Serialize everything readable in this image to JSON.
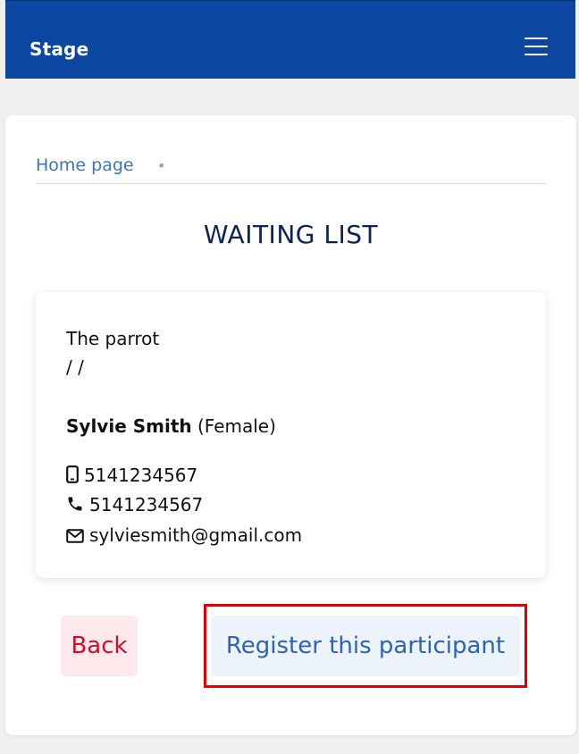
{
  "header": {
    "brand": "Stage",
    "menu_icon": "hamburger-menu-icon",
    "background_color": "#0b47a1"
  },
  "breadcrumb": {
    "home_label": "Home page",
    "separator": "•"
  },
  "page": {
    "title": "WAITING LIST"
  },
  "participant": {
    "activity": "The parrot",
    "date": "/ /",
    "name": "Sylvie Smith",
    "gender": "(Female)",
    "mobile": "5141234567",
    "phone": "5141234567",
    "email": "sylviesmith@gmail.com",
    "icons": [
      "mobile-phone-icon",
      "phone-icon",
      "envelope-icon"
    ]
  },
  "actions": {
    "back_label": "Back",
    "register_label": "Register this participant",
    "back_color": "#c8102e",
    "register_color": "#2d62b8",
    "highlight_color": "#e00000"
  }
}
